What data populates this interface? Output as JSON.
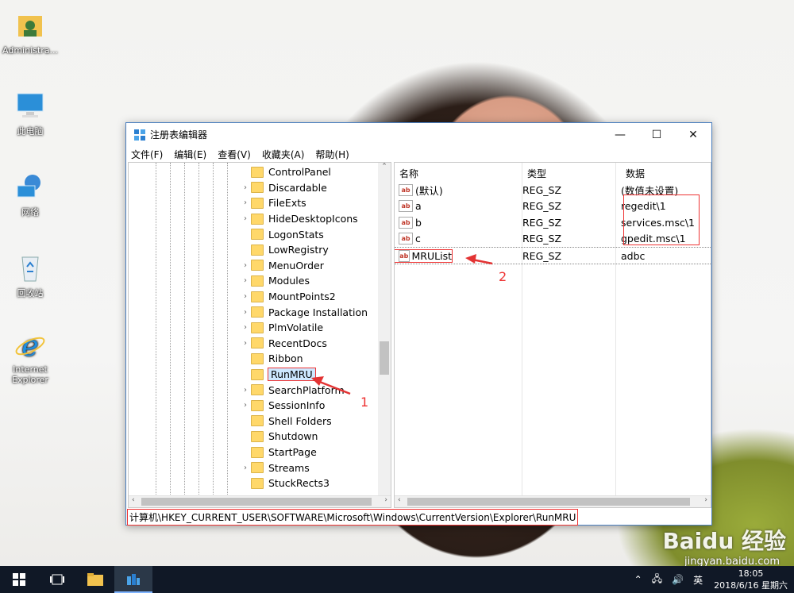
{
  "desktop": {
    "icons": [
      {
        "label": "Administra..."
      },
      {
        "label": "此电脑"
      },
      {
        "label": "网络"
      },
      {
        "label": "回收站"
      },
      {
        "label": "Internet Explorer"
      }
    ]
  },
  "window": {
    "title": "注册表编辑器",
    "controls": {
      "minimize": "—",
      "maximize": "☐",
      "close": "✕"
    },
    "menu": [
      "文件(F)",
      "编辑(E)",
      "查看(V)",
      "收藏夹(A)",
      "帮助(H)"
    ]
  },
  "tree": {
    "items": [
      {
        "label": "ControlPanel",
        "expandable": false
      },
      {
        "label": "Discardable",
        "expandable": true
      },
      {
        "label": "FileExts",
        "expandable": true
      },
      {
        "label": "HideDesktopIcons",
        "expandable": true
      },
      {
        "label": "LogonStats",
        "expandable": false
      },
      {
        "label": "LowRegistry",
        "expandable": false
      },
      {
        "label": "MenuOrder",
        "expandable": true
      },
      {
        "label": "Modules",
        "expandable": true
      },
      {
        "label": "MountPoints2",
        "expandable": true
      },
      {
        "label": "Package Installation",
        "expandable": true
      },
      {
        "label": "PlmVolatile",
        "expandable": true
      },
      {
        "label": "RecentDocs",
        "expandable": true
      },
      {
        "label": "Ribbon",
        "expandable": false
      },
      {
        "label": "RunMRU",
        "expandable": false,
        "selected": true
      },
      {
        "label": "SearchPlatform",
        "expandable": true
      },
      {
        "label": "SessionInfo",
        "expandable": true
      },
      {
        "label": "Shell Folders",
        "expandable": false
      },
      {
        "label": "Shutdown",
        "expandable": false
      },
      {
        "label": "StartPage",
        "expandable": false
      },
      {
        "label": "Streams",
        "expandable": true
      },
      {
        "label": "StuckRects3",
        "expandable": false
      }
    ]
  },
  "values_list": {
    "headers": {
      "name": "名称",
      "type": "类型",
      "data": "数据"
    },
    "rows": [
      {
        "name": "(默认)",
        "type": "REG_SZ",
        "data": "(数值未设置)"
      },
      {
        "name": "a",
        "type": "REG_SZ",
        "data": "regedit\\1"
      },
      {
        "name": "b",
        "type": "REG_SZ",
        "data": "services.msc\\1"
      },
      {
        "name": "c",
        "type": "REG_SZ",
        "data": "gpedit.msc\\1"
      },
      {
        "name": "MRUList",
        "type": "REG_SZ",
        "data": "adbc"
      }
    ]
  },
  "statusbar": {
    "path": "计算机\\HKEY_CURRENT_USER\\SOFTWARE\\Microsoft\\Windows\\CurrentVersion\\Explorer\\RunMRU"
  },
  "annotations": {
    "label1": "1",
    "label2": "2"
  },
  "taskbar": {
    "tray_lang": "英",
    "time": "18:05",
    "date": "2018/6/16 星期六"
  },
  "watermark": {
    "text": "Baidu 经验",
    "url": "jingyan.baidu.com"
  },
  "colors": {
    "annotation": "#e33333",
    "selection": "#cde8ff",
    "taskbar": "#101826",
    "window_border": "#4b7fbf"
  }
}
